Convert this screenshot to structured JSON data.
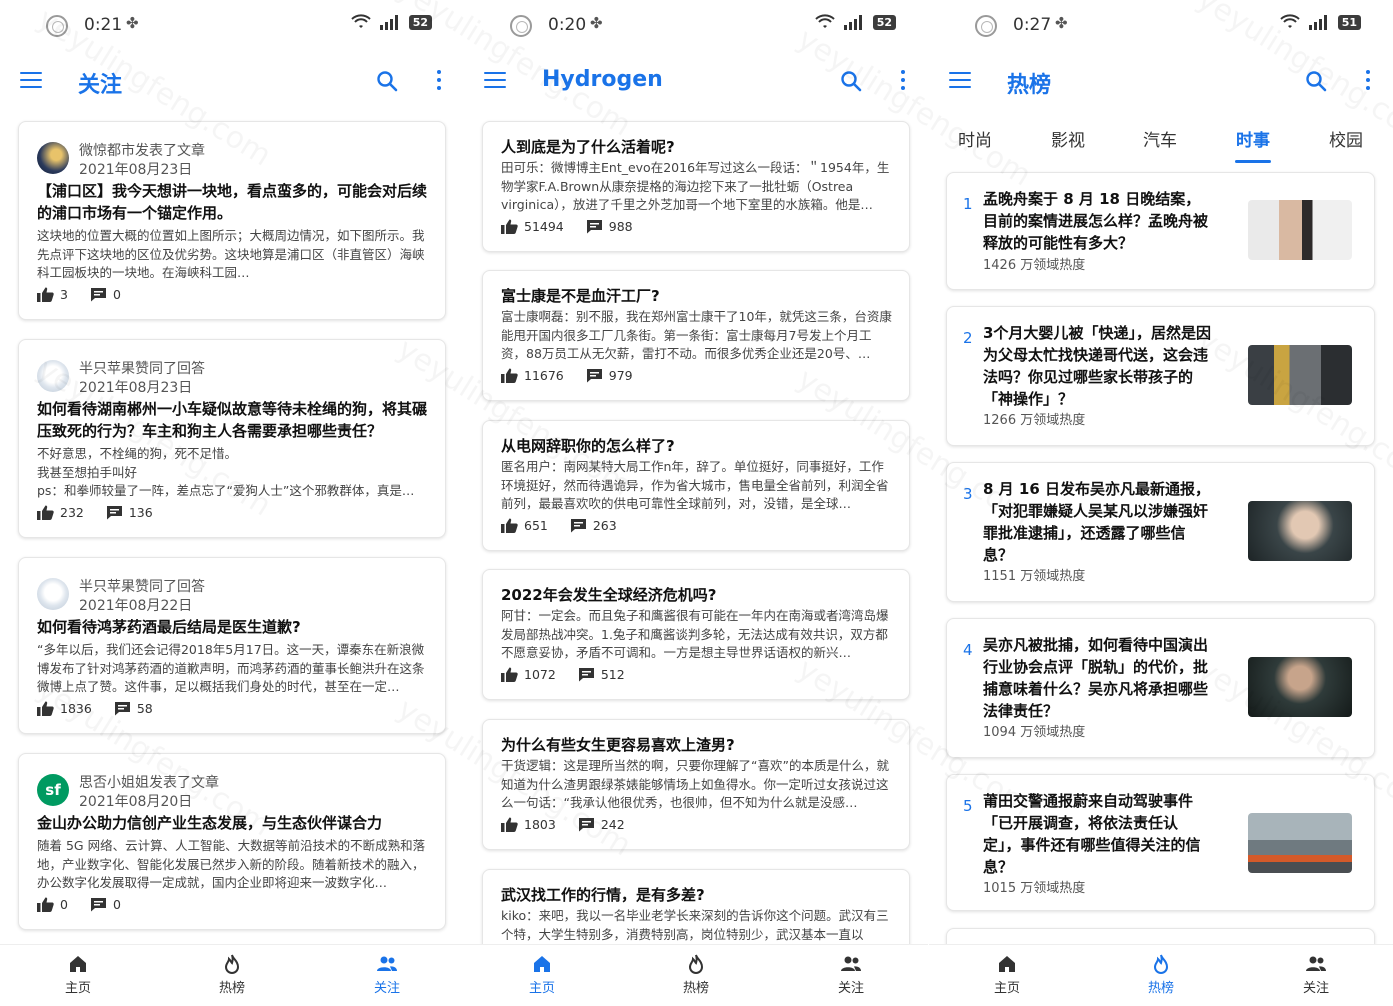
{
  "panels": [
    {
      "status": {
        "time": "0:21",
        "battery": "52"
      },
      "title": "关注",
      "cards": [
        {
          "author": "微惊都市发表了文章",
          "date": "2021年08月23日",
          "title": "【浦口区】我今天想讲一块地，看点蛮多的，可能会对后续的浦口市场有一个锚定作用。",
          "body": "这块地的位置大概的位置如上图所示；大概周边情况，如下图所示。我先点评下这块地的区位及优劣势。这块地算是浦口区（非直管区）海峡科工园板块的一块地。在海峡科工园…",
          "likes": "3",
          "comments": "0"
        },
        {
          "author": "半只苹果赞同了回答",
          "date": "2021年08月23日",
          "title": "如何看待湖南郴州一小车疑似故意等待未栓绳的狗，将其碾压致死的行为？车主和狗主人各需要承担哪些责任？",
          "body": "不好意思，不栓绳的狗，死不足惜。\n我甚至想拍手叫好\nps：和拳师较量了一阵，差点忘了“爱狗人士”这个邪教群体，真是…",
          "likes": "232",
          "comments": "136"
        },
        {
          "author": "半只苹果赞同了回答",
          "date": "2021年08月22日",
          "title": "如何看待鸿茅药酒最后结局是医生道歉?",
          "body": "“多年以后，我们还会记得2018年5月17日。这一天，谭秦东在新浪微博发布了针对鸿茅药酒的道歉声明，而鸿茅药酒的董事长鲍洪升在这条微博上点了赞。这件事，足以概括我们身处的时代，甚至在一定…",
          "likes": "1836",
          "comments": "58"
        },
        {
          "author": "思否小姐姐发表了文章",
          "date": "2021年08月20日",
          "title": "金山办公助力信创产业生态发展，与生态伙伴谋合力",
          "body": "随着 5G 网络、云计算、人工智能、大数据等前沿技术的不断成熟和落地，产业数字化、智能化发展已然步入新的阶段。随着新技术的融入，办公数字化发展取得一定成就，国内企业即将迎来一波数字化…",
          "likes": "0",
          "comments": "0"
        }
      ],
      "nav": [
        "主页",
        "热榜",
        "关注"
      ]
    },
    {
      "status": {
        "time": "0:20",
        "battery": "52"
      },
      "title": "Hydrogen",
      "cards": [
        {
          "title": "人到底是为了什么活着呢?",
          "body": "田可乐：微博博主Ent_evo在2016年写过这么一段话：＂1954年，生物学家F.A.Brown从康奈提格的海边挖下来了一批牡蛎（Ostrea virginica），放进了千里之外芝加哥一个地下室里的水族箱。他是…",
          "likes": "51494",
          "comments": "988"
        },
        {
          "title": "富士康是不是血汗工厂?",
          "body": "富士康啊磊：别不服，我在郑州富士康干了10年，就凭这三条，台资康能甩开国内很多工厂几条街。第一条街：富士康每月7号发上个月工资，88万员工从无欠薪，雷打不动。而很多优秀企业还是20号、…",
          "likes": "11676",
          "comments": "979"
        },
        {
          "title": "从电网辞职你的怎么样了?",
          "body": "匿名用户：南网某特大局工作n年，辞了。单位挺好，同事挺好，工作环境挺好，然而待遇诡异，作为省大城市，售电量全省前列，利润全省前列，最最喜欢吹的供电可靠性全球前列，对，没错，是全球…",
          "likes": "651",
          "comments": "263"
        },
        {
          "title": "2022年会发生全球经济危机吗?",
          "body": "阿甘：一定会。而且兔子和鹰酱很有可能在一年内在南海或者湾湾岛爆发局部热战冲突。1.兔子和鹰酱谈判多轮，无法达成有效共识，双方都不愿意妥协，矛盾不可调和。一方是想主导世界话语权的新兴…",
          "likes": "1072",
          "comments": "512"
        },
        {
          "title": "为什么有些女生更容易喜欢上渣男?",
          "body": "干货逻辑：这是理所当然的啊，只要你理解了“喜欢”的本质是什么，就知道为什么渣男跟绿茶婊能够情场上如鱼得水。你一定听过女孩说过这么一句话：“我承认他很优秀，也很帅，但不知为什么就是没感…",
          "likes": "1803",
          "comments": "242"
        },
        {
          "title": "武汉找工作的行情，是有多差?",
          "body": "kiko：来吧，我以一名毕业老学长来深刻的告诉你这个问题。武汉有三个特，大学生特别多，消费特别高，岗位特别少，武汉基本一直以",
          "likes": "",
          "comments": ""
        }
      ],
      "nav": [
        "主页",
        "热榜",
        "关注"
      ]
    },
    {
      "status": {
        "time": "0:27",
        "battery": "51"
      },
      "title": "热榜",
      "tabs": [
        "时尚",
        "影视",
        "汽车",
        "时事",
        "校园"
      ],
      "active_tab": "时事",
      "items": [
        {
          "rank": "1",
          "title": "孟晚舟案于 8 月 18 日晚结案，目前的案情进展怎么样？孟晚舟被释放的可能性有多大？",
          "heat": "1426 万领域热度"
        },
        {
          "rank": "2",
          "title": "3个月大婴儿被「快递」，居然是因为父母太忙找快递哥代送，这会违法吗？你见过哪些家长带孩子的「神操作」？",
          "heat": "1266 万领域热度"
        },
        {
          "rank": "3",
          "title": "8 月 16 日发布吴亦凡最新通报，「对犯罪嫌疑人吴某凡以涉嫌强奸罪批准逮捕」，还透露了哪些信息？",
          "heat": "1151 万领域热度"
        },
        {
          "rank": "4",
          "title": "吴亦凡被批捕，如何看待中国演出行业协会点评「脱轨」的代价，批捕意味着什么？吴亦凡将承担哪些法律责任？",
          "heat": "1094 万领域热度"
        },
        {
          "rank": "5",
          "title": "莆田交警通报蔚来自动驾驶事件「已开展调查，将依法责任认定」，事件还有哪些值得关注的信息？",
          "heat": "1015 万领域热度"
        }
      ],
      "nav": [
        "主页",
        "热榜",
        "关注"
      ]
    }
  ],
  "watermark": "yeyulingfeng.com",
  "colors": {
    "accent": "#1a73e8"
  }
}
